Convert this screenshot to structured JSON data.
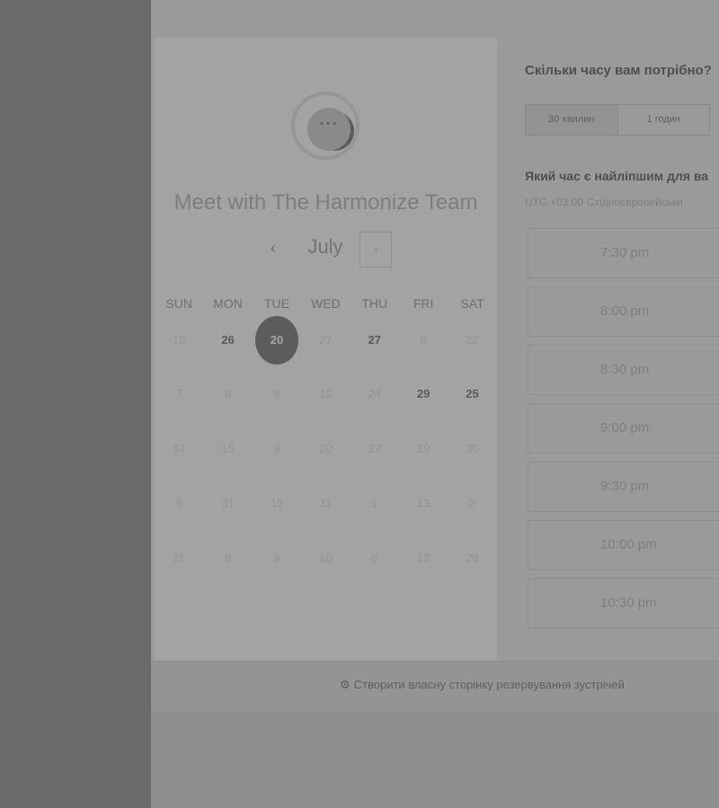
{
  "calendar": {
    "title": "Meet with The Harmonize Team",
    "month": "July",
    "prev_icon": "‹",
    "next_icon": "›",
    "weekdays": [
      "SUN",
      "MON",
      "TUE",
      "WED",
      "THU",
      "FRI",
      "SAT"
    ],
    "weeks": [
      [
        {
          "d": "19",
          "s": "dim"
        },
        {
          "d": "26",
          "s": "available"
        },
        {
          "d": "20",
          "s": "selected"
        },
        {
          "d": "27",
          "s": "dim"
        },
        {
          "d": "27",
          "s": "available"
        },
        {
          "d": "8",
          "s": "dim"
        },
        {
          "d": "22",
          "s": "dim"
        }
      ],
      [
        {
          "d": "7",
          "s": "dim"
        },
        {
          "d": "8",
          "s": "dim"
        },
        {
          "d": "8",
          "s": "dim"
        },
        {
          "d": "19",
          "s": "dim"
        },
        {
          "d": "24",
          "s": "dim"
        },
        {
          "d": "29",
          "s": "available"
        },
        {
          "d": "25",
          "s": "available"
        }
      ],
      [
        {
          "d": "14",
          "s": "dim"
        },
        {
          "d": "15",
          "s": "dim"
        },
        {
          "d": "9",
          "s": "dim"
        },
        {
          "d": "20",
          "s": "dim"
        },
        {
          "d": "17",
          "s": "dim"
        },
        {
          "d": "19",
          "s": "dim"
        },
        {
          "d": "30",
          "s": "dim"
        }
      ],
      [
        {
          "d": "9",
          "s": "dim"
        },
        {
          "d": "31",
          "s": "dim"
        },
        {
          "d": "12",
          "s": "dim"
        },
        {
          "d": "11",
          "s": "dim"
        },
        {
          "d": "1",
          "s": "dim"
        },
        {
          "d": "13",
          "s": "dim"
        },
        {
          "d": "2",
          "s": "dim"
        }
      ],
      [
        {
          "d": "15",
          "s": "dim"
        },
        {
          "d": "8",
          "s": "dim"
        },
        {
          "d": "9",
          "s": "dim"
        },
        {
          "d": "10",
          "s": "dim"
        },
        {
          "d": "6",
          "s": "dim"
        },
        {
          "d": "12",
          "s": "dim"
        },
        {
          "d": "28",
          "s": "dim"
        }
      ]
    ]
  },
  "scheduler": {
    "duration_question": "Скільки часу вам потрібно?",
    "durations": [
      "30 хвилин",
      "1 годин"
    ],
    "time_question": "Який час є найліпшим для ва",
    "timezone": "UTC +03:00 Східноєвропейськи",
    "slots": [
      "7:30 pm",
      "8:00 pm",
      "8:30 pm",
      "9:00 pm",
      "9:30 pm",
      "10:00 pm",
      "10:30 pm"
    ]
  },
  "footer": {
    "link_text": "Створити власну сторінку резервування зустрічей"
  }
}
